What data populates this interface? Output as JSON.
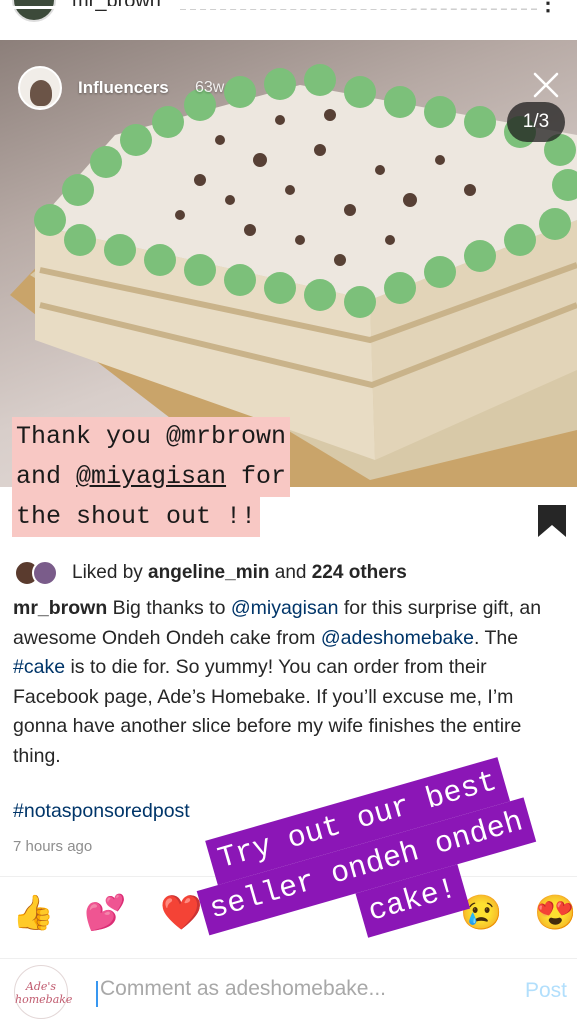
{
  "top": {
    "username": "mr_brown",
    "more_glyph": "⋮"
  },
  "story": {
    "progress": 0.72,
    "user": "Influencers",
    "time": "63w",
    "page": "1/3"
  },
  "shout": {
    "l1_a": "Thank you ",
    "l1_b": "@mrbrown",
    "l2_a": "and ",
    "l2_b": "@miyagisan",
    "l2_c": " for",
    "l3": "the shout out !!"
  },
  "post": {
    "likes_prefix": "Liked by ",
    "likes_user": "angeline_min",
    "likes_mid": " and ",
    "likes_count": "224 others",
    "caption": {
      "user": "mr_brown",
      "t1": " Big thanks to ",
      "m1": "@miyagisan",
      "t2": " for this surprise gift, an awesome Ondeh Ondeh cake from ",
      "m2": "@adeshomebake",
      "t3": ". The ",
      "h1": "#cake",
      "t4": " is to die for. So yummy! You can order from their Facebook page, Ade’s Homebake. If you’ll excuse me, I’m gonna have another slice before my wife finishes the entire thing."
    },
    "hashtag": "#notasponsoredpost",
    "timestamp": "7 hours ago"
  },
  "emojis": [
    "👍",
    "💕",
    "❤️",
    "😢",
    "😍"
  ],
  "promo": {
    "l1": "Try out our best",
    "l2": "seller ondeh ondeh",
    "l3": "cake!"
  },
  "comment": {
    "logo_l1": "Ade's",
    "logo_l2": "homebake",
    "placeholder": "Comment as adeshomebake...",
    "post_label": "Post"
  },
  "colors": {
    "mention": "#003569",
    "promo_bg": "#8b16b6",
    "shout_bg": "#f8c8c4",
    "post_disabled": "#b2dffc"
  },
  "icons": [
    "close-icon",
    "bookmark-icon",
    "caret-icon"
  ]
}
